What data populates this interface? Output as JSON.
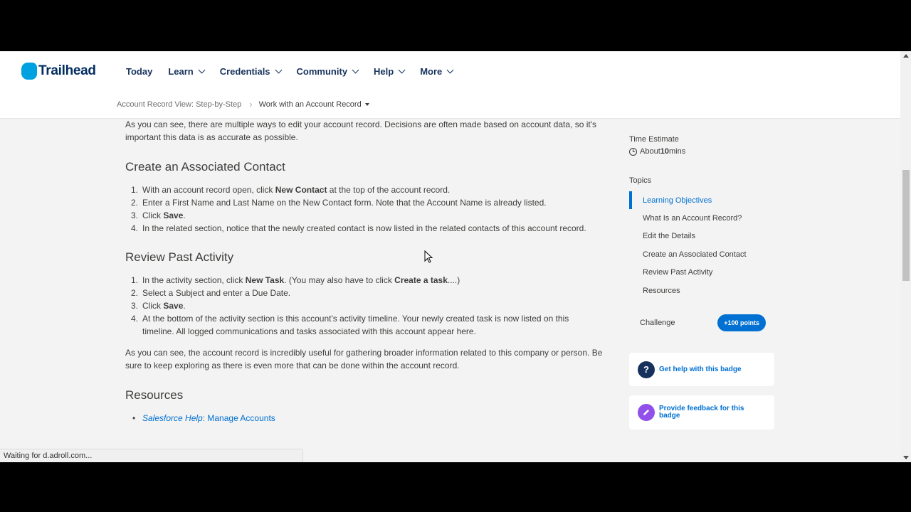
{
  "header": {
    "logo_text": "Trailhead",
    "nav": [
      {
        "label": "Today",
        "dropdown": false
      },
      {
        "label": "Learn",
        "dropdown": true
      },
      {
        "label": "Credentials",
        "dropdown": true
      },
      {
        "label": "Community",
        "dropdown": true
      },
      {
        "label": "Help",
        "dropdown": true
      },
      {
        "label": "More",
        "dropdown": true
      }
    ],
    "breadcrumb": {
      "parent": "Account Record View: Step-by-Step",
      "current": "Work with an Account Record"
    }
  },
  "content": {
    "intro": "As you can see, there are multiple ways to edit your account record. Decisions are often made based on account data, so it's important this data is as accurate as possible.",
    "section1": {
      "heading": "Create an Associated Contact",
      "steps": [
        {
          "num": "1.",
          "pre": "With an account record open, click ",
          "bold": "New Contact",
          "post": " at the top of the account record."
        },
        {
          "num": "2.",
          "pre": "Enter a First Name and Last Name on the New Contact form. Note that the Account Name is already listed.",
          "bold": "",
          "post": ""
        },
        {
          "num": "3.",
          "pre": "Click ",
          "bold": "Save",
          "post": "."
        },
        {
          "num": "4.",
          "pre": "In the related section, notice that the newly created contact is now listed in the related contacts of this account record.",
          "bold": "",
          "post": ""
        }
      ]
    },
    "section2": {
      "heading": "Review Past Activity",
      "steps": [
        {
          "num": "1.",
          "pre": "In the activity section, click ",
          "bold": "New Task",
          "post": ". (You may also have to click ",
          "bold2": "Create a task",
          "post2": "....)"
        },
        {
          "num": "2.",
          "pre": "Select a Subject and enter a Due Date.",
          "bold": "",
          "post": ""
        },
        {
          "num": "3.",
          "pre": "Click ",
          "bold": "Save",
          "post": "."
        },
        {
          "num": "4.",
          "pre": "At the bottom of the activity section is this account's activity timeline. Your newly created task is now listed on this timeline. All logged communications and tasks associated with this account appear here.",
          "bold": "",
          "post": ""
        }
      ],
      "closing": "As you can see, the account record is incredibly useful for gathering broader information related to this company or person. Be sure to keep exploring as there is even more that can be done within the account record."
    },
    "resources": {
      "heading": "Resources",
      "link_italic": "Salesforce Help",
      "link_rest": ": Manage Accounts"
    }
  },
  "sidebar": {
    "time_label": "Time Estimate",
    "time_prefix": "About ",
    "time_value": "10",
    "time_suffix": " mins",
    "topics_label": "Topics",
    "topics": [
      {
        "label": "Learning Objectives",
        "active": true
      },
      {
        "label": "What Is an Account Record?",
        "active": false
      },
      {
        "label": "Edit the Details",
        "active": false
      },
      {
        "label": "Create an Associated Contact",
        "active": false
      },
      {
        "label": "Review Past Activity",
        "active": false
      },
      {
        "label": "Resources",
        "active": false
      }
    ],
    "challenge_label": "Challenge",
    "points": "+100 points",
    "help_card": {
      "icon": "question-icon",
      "text": "Get help with this badge",
      "color": "#16325c"
    },
    "feedback_card": {
      "icon": "pencil-icon",
      "text": "Provide feedback for this badge",
      "color": "#9050e9"
    }
  },
  "status_bar": "Waiting for d.adroll.com...",
  "colors": {
    "accent": "#0070d2",
    "brand": "#00a1e0",
    "nav_text": "#16325c"
  }
}
